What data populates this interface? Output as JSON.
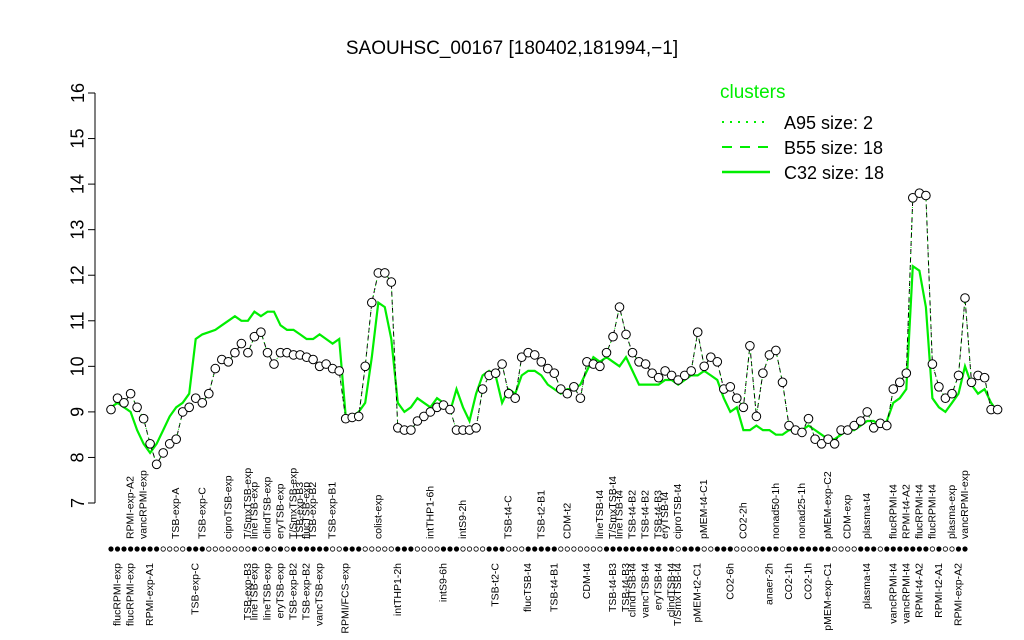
{
  "chart_data": {
    "type": "line",
    "title": "SAOUHSC_00167 [180402,181994,−1]",
    "xlabel": "",
    "ylabel": "",
    "ylim": [
      7,
      16
    ],
    "yticks": [
      7,
      8,
      9,
      10,
      11,
      12,
      13,
      14,
      15,
      16
    ],
    "grid": false,
    "legend": {
      "title": "clusters",
      "placement": "top-right",
      "entries": [
        {
          "label": "A95 size: 2",
          "style": "dotted"
        },
        {
          "label": "B55 size: 18",
          "style": "dashed"
        },
        {
          "label": "C32 size: 18",
          "style": "solid"
        }
      ]
    },
    "series_colors": {
      "points": "#000000",
      "cluster_line": "#00ee00",
      "profile_line": "#000000"
    },
    "top_labels": [
      {
        "label": "RPMI-exp-A2",
        "index": 3
      },
      {
        "label": "vancRPMI-exp",
        "index": 5
      },
      {
        "label": "TSB-exp-A",
        "index": 10
      },
      {
        "label": "TSB-exp-C",
        "index": 14
      },
      {
        "label": "ciproTSB-exp",
        "index": 18
      },
      {
        "label": "T/SmxTSB-exp",
        "index": 21
      },
      {
        "label": "lineTSB-exp",
        "index": 22
      },
      {
        "label": "clindTSB-exp",
        "index": 24
      },
      {
        "label": "eryTSB-exp",
        "index": 26
      },
      {
        "label": "T/SmxTSB-exp",
        "index": 28
      },
      {
        "label": "TSB-exp-B3",
        "index": 29
      },
      {
        "label": "flucTSB-exp",
        "index": 30
      },
      {
        "label": "TSB-exp-B2",
        "index": 31
      },
      {
        "label": "TSB-exp-B1",
        "index": 34
      },
      {
        "label": "colist-exp",
        "index": 41
      },
      {
        "label": "intTHP1-6h",
        "index": 49
      },
      {
        "label": "intS9-2h",
        "index": 54
      },
      {
        "label": "TSB-t4-C",
        "index": 61
      },
      {
        "label": "TSB-t2-B1",
        "index": 66
      },
      {
        "label": "CDM-t2",
        "index": 70
      },
      {
        "label": "lineTSB-t4",
        "index": 75
      },
      {
        "label": "T/SmxTSB-t4",
        "index": 77
      },
      {
        "label": "lineTSB-t4",
        "index": 78
      },
      {
        "label": "TSB-t4-B2",
        "index": 80
      },
      {
        "label": "TSB-t4-B2",
        "index": 82
      },
      {
        "label": "TSB-t4-B3",
        "index": 84
      },
      {
        "label": "eryTSB-t4",
        "index": 85
      },
      {
        "label": "ciproTSB-t4",
        "index": 87
      },
      {
        "label": "pMEM-t4-C1",
        "index": 91
      },
      {
        "label": "CO2-2h",
        "index": 97
      },
      {
        "label": "nonad50-1h",
        "index": 102
      },
      {
        "label": "nonad25-1h",
        "index": 106
      },
      {
        "label": "pMEM-exp-C2",
        "index": 110
      },
      {
        "label": "CDM-exp",
        "index": 113
      },
      {
        "label": "plasma-t4",
        "index": 116
      },
      {
        "label": "flucRPMI-t4",
        "index": 120
      },
      {
        "label": "RPMI-t4-A2",
        "index": 122
      },
      {
        "label": "flucRPMI-t4",
        "index": 124
      },
      {
        "label": "flucRPMI-t4",
        "index": 126
      },
      {
        "label": "plasma-exp",
        "index": 129
      },
      {
        "label": "vancRPMI-exp",
        "index": 131
      }
    ],
    "bottom_labels": [
      {
        "label": "flucRPMI-exp",
        "index": 1
      },
      {
        "label": "flucRPMI-exp",
        "index": 3
      },
      {
        "label": "RPMI-exp-A1",
        "index": 6
      },
      {
        "label": "TSB-exp-C",
        "index": 13
      },
      {
        "label": "TSB-exp-B3",
        "index": 21
      },
      {
        "label": "lineTSB-exp",
        "index": 22
      },
      {
        "label": "lineTSB-exp",
        "index": 24
      },
      {
        "label": "eryTSB-exp",
        "index": 26
      },
      {
        "label": "TSB-exp-B2",
        "index": 28
      },
      {
        "label": "TSB-exp-B2",
        "index": 30
      },
      {
        "label": "vancTSB-exp",
        "index": 32
      },
      {
        "label": "RPMI/FCS-exp",
        "index": 36
      },
      {
        "label": "intTHP1-2h",
        "index": 44
      },
      {
        "label": "intS9-6h",
        "index": 51
      },
      {
        "label": "TSB-t2-C",
        "index": 59
      },
      {
        "label": "flucTSB-t4",
        "index": 64
      },
      {
        "label": "TSB-t4-B1",
        "index": 68
      },
      {
        "label": "CDM-t4",
        "index": 73
      },
      {
        "label": "TSB-t4-B3",
        "index": 77
      },
      {
        "label": "TSB-t4-B3",
        "index": 79
      },
      {
        "label": "clindTSB-t4",
        "index": 80
      },
      {
        "label": "vancTSB-t4",
        "index": 82
      },
      {
        "label": "eryTSB-t4",
        "index": 84
      },
      {
        "label": "clindTSB-t4",
        "index": 86
      },
      {
        "label": "T/SmxTSB-t4",
        "index": 87
      },
      {
        "label": "pMEM-t2-C1",
        "index": 90
      },
      {
        "label": "CO2-6h",
        "index": 95
      },
      {
        "label": "anaer-2h",
        "index": 101
      },
      {
        "label": "CO2-1h",
        "index": 104
      },
      {
        "label": "CO2-1h",
        "index": 107
      },
      {
        "label": "pMEM-exp-C1",
        "index": 110
      },
      {
        "label": "plasma-t4",
        "index": 116
      },
      {
        "label": "vancRPMI-t4",
        "index": 120
      },
      {
        "label": "vancRPMI-t4",
        "index": 122
      },
      {
        "label": "RPMI-t4-A2",
        "index": 124
      },
      {
        "label": "RPMI-t2-A1",
        "index": 127
      },
      {
        "label": "RPMI-exp-A2",
        "index": 130
      }
    ],
    "n_samples": 132,
    "values": [
      9.05,
      9.3,
      9.2,
      9.4,
      9.1,
      8.85,
      8.3,
      7.85,
      8.1,
      8.3,
      8.4,
      9.0,
      9.1,
      9.3,
      9.2,
      9.4,
      9.95,
      10.15,
      10.1,
      10.3,
      10.5,
      10.3,
      10.65,
      10.75,
      10.3,
      10.05,
      10.3,
      10.3,
      10.25,
      10.25,
      10.2,
      10.15,
      10.0,
      10.05,
      9.95,
      9.9,
      8.85,
      8.88,
      8.9,
      10.0,
      11.4,
      12.05,
      12.05,
      11.85,
      8.65,
      8.6,
      8.6,
      8.8,
      8.9,
      9.0,
      9.1,
      9.15,
      9.05,
      8.6,
      8.6,
      8.6,
      8.65,
      9.5,
      9.8,
      9.85,
      10.05,
      9.4,
      9.3,
      10.2,
      10.3,
      10.25,
      10.1,
      9.95,
      9.85,
      9.5,
      9.4,
      9.55,
      9.3,
      10.1,
      10.05,
      10.0,
      10.3,
      10.65,
      11.3,
      10.7,
      10.3,
      10.1,
      10.05,
      9.85,
      9.75,
      9.9,
      9.8,
      9.7,
      9.8,
      9.9,
      10.75,
      10.0,
      10.2,
      10.1,
      9.5,
      9.55,
      9.3,
      9.1,
      10.45,
      8.9,
      9.85,
      10.25,
      10.35,
      9.65,
      8.7,
      8.6,
      8.55,
      8.85,
      8.4,
      8.3,
      8.4,
      8.3,
      8.6,
      8.6,
      8.7,
      8.8,
      9.0,
      8.65,
      8.75,
      8.7,
      9.5,
      9.65,
      9.85,
      13.7,
      13.8,
      13.75,
      10.05,
      9.55,
      9.3,
      9.4,
      9.8,
      11.5,
      9.65,
      9.8,
      9.75,
      9.05,
      9.05
    ],
    "cluster_line": [
      9.1,
      9.2,
      9.1,
      9.0,
      8.6,
      8.3,
      8.1,
      8.3,
      8.6,
      8.9,
      9.1,
      9.2,
      9.4,
      10.6,
      10.7,
      10.75,
      10.8,
      10.9,
      11.0,
      11.1,
      11.0,
      11.0,
      11.2,
      11.1,
      11.2,
      11.2,
      10.9,
      10.8,
      10.8,
      10.7,
      10.6,
      10.6,
      10.7,
      10.6,
      10.5,
      10.6,
      8.9,
      8.9,
      9.0,
      9.2,
      10.2,
      11.4,
      11.3,
      10.6,
      9.2,
      9.0,
      9.1,
      9.3,
      9.2,
      9.1,
      9.3,
      9.2,
      9.0,
      9.5,
      9.1,
      8.8,
      9.4,
      9.8,
      9.9,
      9.8,
      9.2,
      9.5,
      9.4,
      9.8,
      9.9,
      9.9,
      9.8,
      9.6,
      9.5,
      9.4,
      9.5,
      9.5,
      9.6,
      9.9,
      10.2,
      10.1,
      10.2,
      10.1,
      10.0,
      10.2,
      9.9,
      9.6,
      9.6,
      9.6,
      9.6,
      9.7,
      9.7,
      9.6,
      9.7,
      9.8,
      9.8,
      9.9,
      9.8,
      9.7,
      9.3,
      9.0,
      9.1,
      8.6,
      8.6,
      8.7,
      8.6,
      8.6,
      8.5,
      8.5,
      8.6,
      8.6,
      8.6,
      8.7,
      8.6,
      8.5,
      8.4,
      8.4,
      8.5,
      8.6,
      8.6,
      8.7,
      8.8,
      8.8,
      8.7,
      8.8,
      9.2,
      9.3,
      9.5,
      12.2,
      12.1,
      11.3,
      9.3,
      9.1,
      9.0,
      9.2,
      9.4,
      10.0,
      9.6,
      9.4,
      9.5,
      9.2,
      9.0
    ]
  }
}
